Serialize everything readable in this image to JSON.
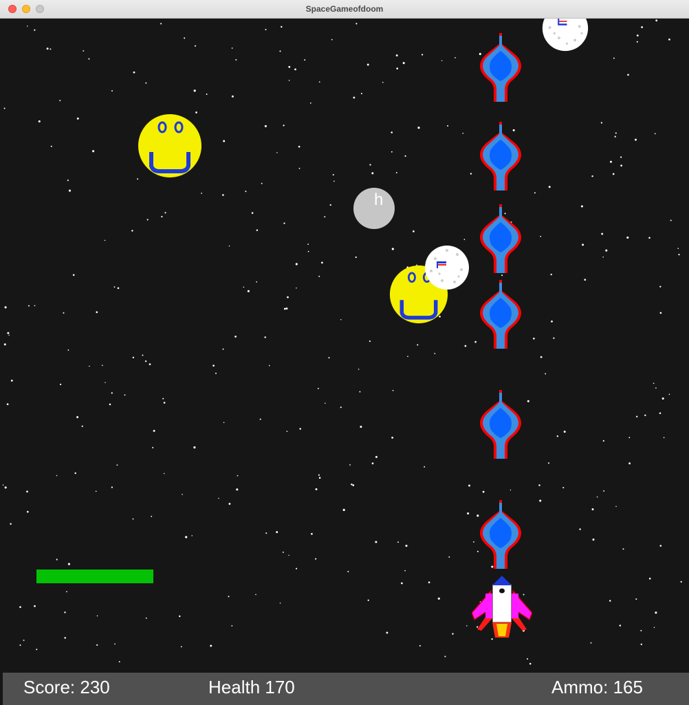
{
  "window": {
    "title": "SpaceGameofdoom"
  },
  "hud": {
    "score_text": "Score: 230",
    "health_text": "Health 170",
    "ammo_text": "Ammo: 165"
  },
  "game": {
    "health_value": 170,
    "health_bar_color": "#05c105",
    "moon_label": "h"
  },
  "colors": {
    "background": "#161616",
    "hud_background": "#505050",
    "smiley": "#f5f000",
    "smiley_features": "#1e3ad8",
    "enemy_outline": "#ff0000",
    "enemy_body": "#0a64ff",
    "player_body": "#ffffff",
    "player_fins": "#ff1aff"
  },
  "icons": {
    "enemy": "enemy-ship-icon",
    "player": "player-rocket-icon",
    "smiley": "smiley-face-icon",
    "moon": "moon-icon",
    "asteroid": "asteroid-icon"
  }
}
